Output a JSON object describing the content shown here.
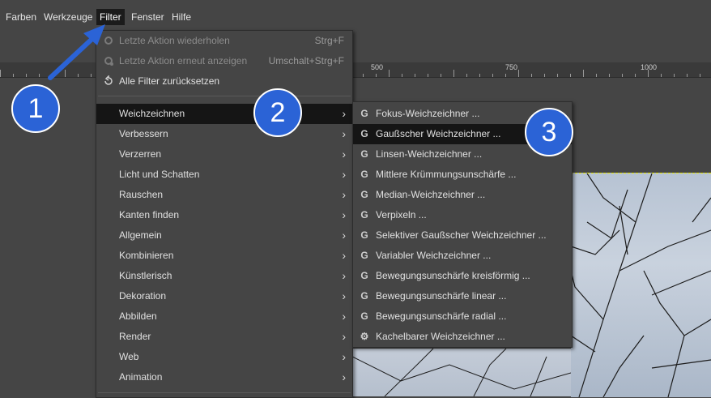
{
  "menubar": {
    "items": [
      "Farben",
      "Werkzeuge",
      "Filter",
      "Fenster",
      "Hilfe"
    ]
  },
  "ruler": {
    "labels": [
      "500",
      "750",
      "1000"
    ]
  },
  "filter_menu": {
    "top_items": [
      {
        "label": "Letzte Aktion wiederholen",
        "shortcut": "Strg+F",
        "disabled": true
      },
      {
        "label": "Letzte Aktion erneut anzeigen",
        "shortcut": "Umschalt+Strg+F",
        "disabled": true
      },
      {
        "label": "Alle Filter zurücksetzen",
        "shortcut": "",
        "disabled": false
      }
    ],
    "categories": [
      "Weichzeichnen",
      "Verbessern",
      "Verzerren",
      "Licht und Schatten",
      "Rauschen",
      "Kanten finden",
      "Allgemein",
      "Kombinieren",
      "Künstlerisch",
      "Dekoration",
      "Abbilden",
      "Render",
      "Web",
      "Animation"
    ]
  },
  "blur_submenu": {
    "items": [
      "Fokus-Weichzeichner ...",
      "Gaußscher Weichzeichner ...",
      "Linsen-Weichzeichner ...",
      "Mittlere Krümmungsunschärfe ...",
      "Median-Weichzeichner ...",
      "Verpixeln ...",
      "Selektiver Gaußscher Weichzeichner ...",
      "Variabler Weichzeichner ...",
      "Bewegungsunschärfe kreisförmig ...",
      "Bewegungsunschärfe linear ...",
      "Bewegungsunschärfe radial ...",
      "Kachelbarer Weichzeichner ..."
    ]
  },
  "annotations": [
    "1",
    "2",
    "3"
  ],
  "colors": {
    "badge": "#2b63d6",
    "highlight": "#151515",
    "menu_bg": "#454545"
  }
}
